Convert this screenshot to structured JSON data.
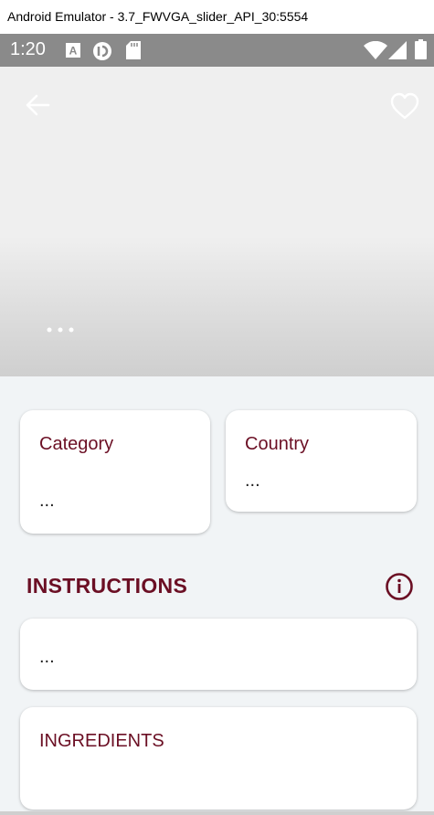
{
  "window": {
    "title": "Android Emulator - 3.7_FWVGA_slider_API_30:5554"
  },
  "status_bar": {
    "time": "1:20",
    "icons": [
      "font-a-icon",
      "pocket-casts-icon",
      "sd-card-icon",
      "wifi-icon",
      "cell-signal-icon",
      "battery-icon"
    ]
  },
  "hero": {
    "icons": {
      "back": "arrow-left-icon",
      "favorite": "heart-outline-icon"
    },
    "pager_dots": 3
  },
  "cards": {
    "category": {
      "label": "Category",
      "value": "..."
    },
    "country": {
      "label": "Country",
      "value": "..."
    }
  },
  "instructions": {
    "title": "INSTRUCTIONS",
    "value": "..."
  },
  "ingredients": {
    "title": "INGREDIENTS"
  },
  "colors": {
    "accent": "#6b0f24",
    "background": "#f1f4f6",
    "status_bar": "#8a8a8a"
  }
}
